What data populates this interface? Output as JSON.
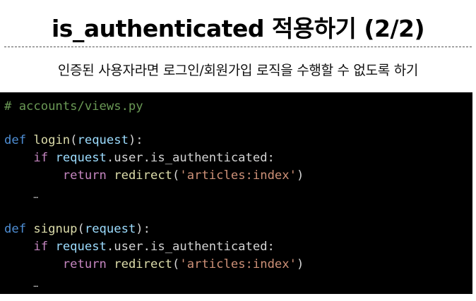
{
  "slide": {
    "title": "is_authenticated 적용하기 (2/2)",
    "subtitle": "인증된 사용자라면 로그인/회원가입 로직을 수행할 수 없도록 하기"
  },
  "code": {
    "comment": "# accounts/views.py",
    "login_def": "def",
    "login_name": "login",
    "login_open": "(",
    "login_param": "request",
    "login_close": "):",
    "login_if": "if",
    "login_cond_obj": "request",
    "login_cond_rest": ".user.is_authenticated:",
    "login_return": "return",
    "login_redirect": "redirect",
    "login_ropen": "(",
    "login_str": "'articles:index'",
    "login_rclose": ")",
    "login_ellipsis": "…",
    "signup_def": "def",
    "signup_name": "signup",
    "signup_open": "(",
    "signup_param": "request",
    "signup_close": "):",
    "signup_if": "if",
    "signup_cond_obj": "request",
    "signup_cond_rest": ".user.is_authenticated:",
    "signup_return": "return",
    "signup_redirect": "redirect",
    "signup_ropen": "(",
    "signup_str": "'articles:index'",
    "signup_rclose": ")",
    "signup_ellipsis": "…"
  },
  "colors": {
    "code_background": "#000000",
    "comment": "#6a9955",
    "keyword": "#4f8fd6",
    "control": "#c586c0",
    "function": "#dcdcaa",
    "parameter": "#9cdcfe",
    "string": "#ce9178"
  }
}
